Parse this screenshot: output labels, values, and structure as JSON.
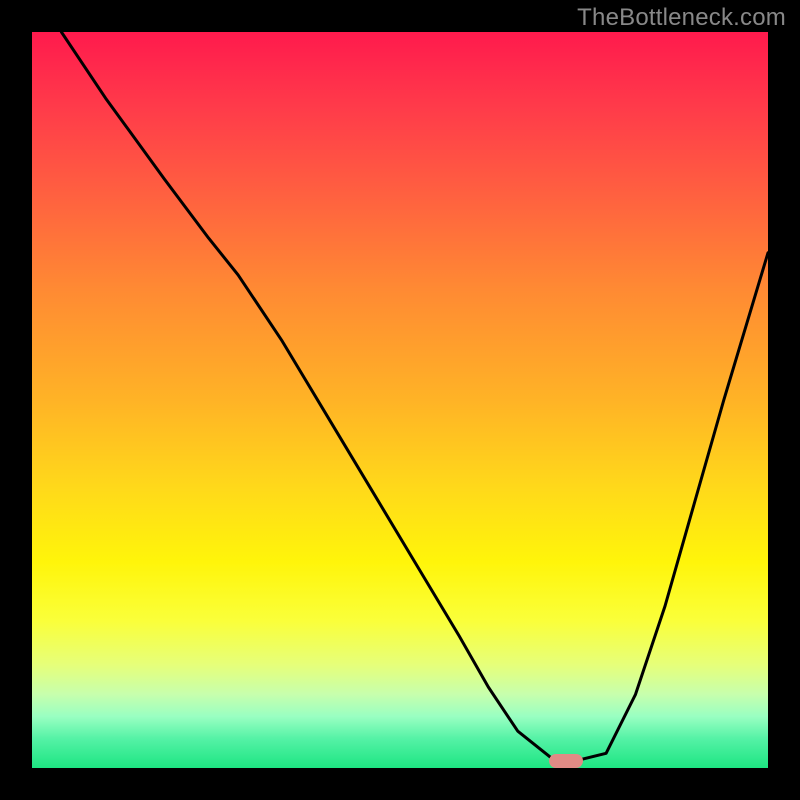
{
  "watermark": "TheBottleneck.com",
  "chart_data": {
    "type": "line",
    "title": "",
    "xlabel": "",
    "ylabel": "",
    "xlim": [
      0,
      100
    ],
    "ylim": [
      0,
      100
    ],
    "series": [
      {
        "name": "curve",
        "x": [
          4,
          10,
          18,
          24,
          28,
          34,
          40,
          46,
          52,
          58,
          62,
          66,
          71,
          74,
          78,
          82,
          86,
          90,
          94,
          100
        ],
        "y": [
          100,
          91,
          80,
          72,
          67,
          58,
          48,
          38,
          28,
          18,
          11,
          5,
          1,
          1,
          2,
          10,
          22,
          36,
          50,
          70
        ]
      }
    ],
    "marker": {
      "x": 72.5,
      "y": 1
    },
    "gradient_stops": [
      {
        "pos": 0,
        "color": "#ff1a4d"
      },
      {
        "pos": 50,
        "color": "#ffb326"
      },
      {
        "pos": 80,
        "color": "#faff3a"
      },
      {
        "pos": 100,
        "color": "#1de582"
      }
    ]
  }
}
